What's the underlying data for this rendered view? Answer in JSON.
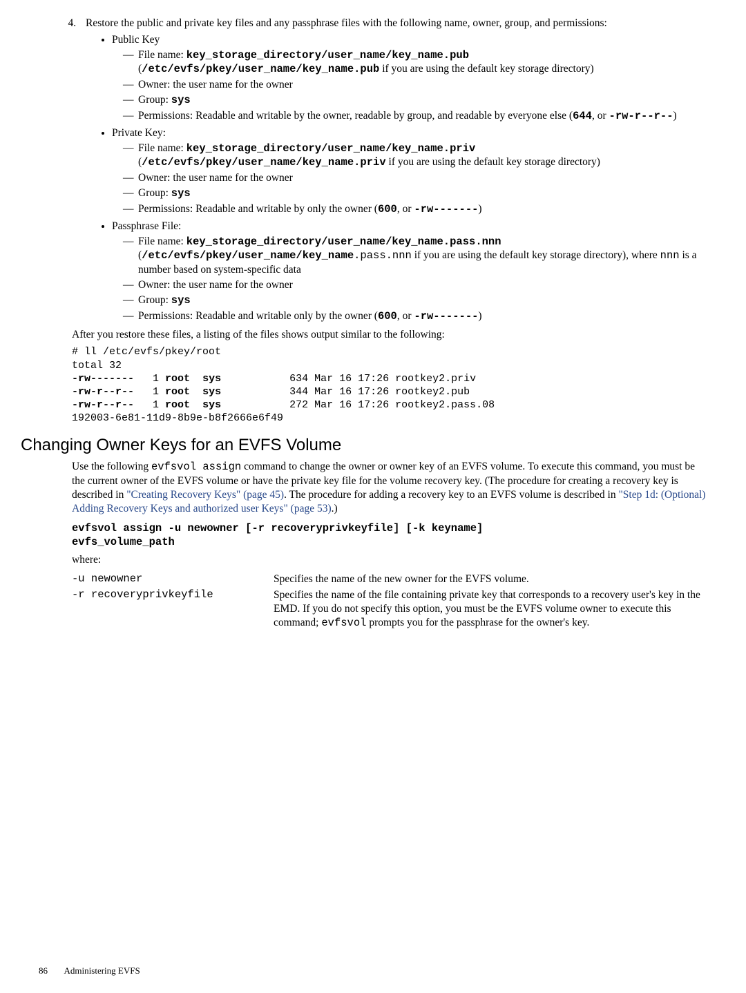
{
  "step4": {
    "num": "4.",
    "intro": "Restore the public and private key files and any passphrase files with the following name, owner, group, and permissions:",
    "public": {
      "title": "Public Key",
      "file_pre": "File name: ",
      "file_name": "key_storage_directory/user_name/key_name.pub",
      "file_paren_open": " (",
      "file_alt": "/etc/evfs/pkey/user_name/key_name.pub",
      "file_paren_tail": " if you are using the default key storage directory)",
      "owner": "Owner: the user name for the owner",
      "group_pre": "Group: ",
      "group_val": "sys",
      "perm_pre": "Permissions: Readable and writable by the owner, readable by group, and readable by everyone else (",
      "perm_num": "644",
      "perm_mid": ", or ",
      "perm_sym": "-rw-r--r--",
      "perm_close": ")"
    },
    "private": {
      "title": "Private Key:",
      "file_pre": "File name: ",
      "file_name": "key_storage_directory/user_name/key_name.priv",
      "file_paren_open": " (",
      "file_alt": "/etc/evfs/pkey/user_name/key_name.priv",
      "file_paren_tail": " if you are using the default key storage directory)",
      "owner": "Owner: the user name for the owner",
      "group_pre": "Group: ",
      "group_val": "sys",
      "perm_pre": "Permissions: Readable and writable by only the owner (",
      "perm_num": "600",
      "perm_mid": ", or ",
      "perm_sym": "-rw-------",
      "perm_close": ")"
    },
    "pass": {
      "title": "Passphrase File:",
      "file_pre": "File name: ",
      "file_name": "key_storage_directory/user_name/key_name.pass.nnn",
      "file_paren_open": " (",
      "file_alt": "/etc/evfs/pkey/user_name/key_name",
      "file_tail1": ".pass.nnn",
      "file_tail2": " if you are using the default key storage directory), where ",
      "file_nnn": "nnn",
      "file_tail3": " is a number based on system-specific data",
      "owner": "Owner: the user name for the owner",
      "group_pre": "Group: ",
      "group_val": "sys",
      "perm_pre": "Permissions: Readable and writable only by the owner (",
      "perm_num": "600",
      "perm_mid": ", or ",
      "perm_sym": "-rw-------",
      "perm_close": ")"
    },
    "after": "After you restore these files, a listing of the files shows output similar to the following:"
  },
  "listing": {
    "l1": "# ll /etc/evfs/pkey/root",
    "l2": "total 32",
    "l3a": "-rw-------",
    "l3b": "   1 ",
    "l3c": "root",
    "l3d": "  ",
    "l3e": "sys",
    "l3f": "           634 Mar 16 17:26 rootkey2.priv",
    "l4a": "-rw-r--r--",
    "l4b": "   1 ",
    "l4c": "root",
    "l4d": "  ",
    "l4e": "sys",
    "l4f": "           344 Mar 16 17:26 rootkey2.pub",
    "l5a": "-rw-r--r--",
    "l5b": "   1 ",
    "l5c": "root",
    "l5d": "  ",
    "l5e": "sys",
    "l5f": "           272 Mar 16 17:26 rootkey2.pass.08",
    "l6": "192003-6e81-11d9-8b9e-b8f2666e6f49"
  },
  "section": {
    "title": "Changing Owner Keys for an EVFS Volume",
    "p1a": "Use the following ",
    "p1b": "evfsvol assign",
    "p1c": " command to change the owner or owner key of an EVFS volume. To execute this command, you must be the current owner of the EVFS volume or have the private key file for the volume recovery key. (The procedure for creating a recovery key is described in ",
    "link1": "\"Creating Recovery Keys\" (page 45)",
    "p1d": ". The procedure for adding a recovery key to an EVFS volume is described in ",
    "link2": "\"Step 1d: (Optional) Adding Recovery Keys and authorized user Keys\" (page 53)",
    "p1e": ".)",
    "cmd1": "evfsvol assign -u newowner [-r recoveryprivkeyfile] [-k keyname]",
    "cmd2": "evfs_volume_path",
    "where": "where:",
    "opt1_name": "-u newowner",
    "opt1_desc": "Specifies the name of the new owner for the EVFS volume.",
    "opt2_name": "-r recoveryprivkeyfile",
    "opt2_desc_a": "Specifies the name of the file containing private key that corresponds to a recovery user's key in the EMD. If you do not specify this option, you must be the EVFS volume owner to execute this command; ",
    "opt2_desc_b": "evfsvol",
    "opt2_desc_c": " prompts you for the passphrase for the owner's key."
  },
  "footer": {
    "page": "86",
    "title": "Administering EVFS"
  }
}
